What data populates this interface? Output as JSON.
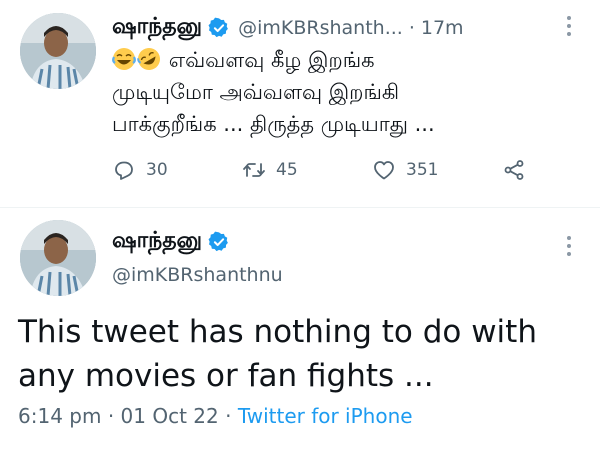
{
  "tweet1": {
    "author_name": "ஷாந்தனு",
    "handle": "@imKBRshanth...",
    "separator": "·",
    "time": "17m",
    "emojis": [
      "joy-emoji",
      "rofl-emoji"
    ],
    "text_line1": "எவ்வளவு கீழ இறங்க",
    "text_line2": "முடியுமோ அவ்வளவு இறங்கி",
    "text_line3": "பாக்குறீங்க ... திருத்த முடியாது ...",
    "reply_count": "30",
    "retweet_count": "45",
    "like_count": "351"
  },
  "tweet2": {
    "author_name": "ஷாந்தனு",
    "handle": "@imKBRshanthnu",
    "text_line1": "This tweet has nothing to do with",
    "text_line2": "any movies or fan fights ...",
    "time": "6:14 pm",
    "sep1": "·",
    "date": "01 Oct 22",
    "sep2": "·",
    "source": "Twitter for iPhone"
  },
  "colors": {
    "text": "#0f1419",
    "secondary": "#536471",
    "accent": "#1d9bf0",
    "verified": "#1d9bf0"
  },
  "icons": [
    "verified-badge-icon",
    "more-icon",
    "reply-icon",
    "retweet-icon",
    "like-icon",
    "share-icon"
  ]
}
